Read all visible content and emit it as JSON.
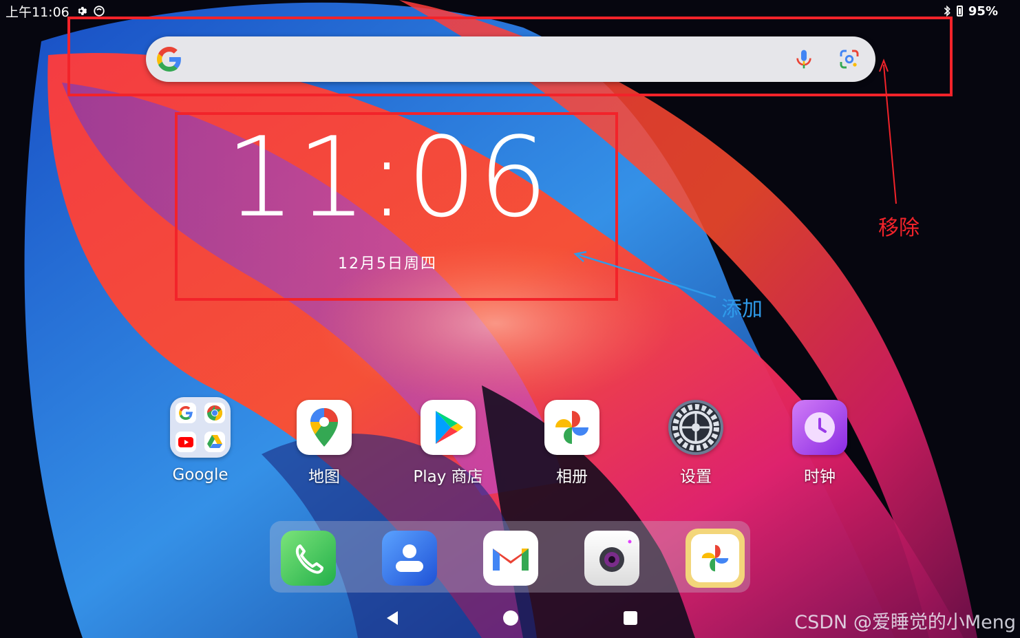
{
  "status_bar": {
    "time": "上午11:06",
    "battery": "95%",
    "icons": [
      "gear-icon",
      "sync-icon",
      "bluetooth-icon",
      "battery-icon"
    ]
  },
  "search_bar": {
    "icons": [
      "google-g-icon",
      "mic-icon",
      "google-lens-icon"
    ]
  },
  "clock_widget": {
    "time": "11:06",
    "date": "12月5日周四"
  },
  "annotations": {
    "remove_label": "移除",
    "add_label": "添加",
    "colors": {
      "box": "#f2232a",
      "remove_text": "#f2232a",
      "add_text": "#2f9bea"
    }
  },
  "apps": [
    {
      "label": "Google",
      "icon": "google-folder-icon"
    },
    {
      "label": "地图",
      "icon": "maps-icon"
    },
    {
      "label": "Play 商店",
      "icon": "play-store-icon"
    },
    {
      "label": "相册",
      "icon": "photos-icon"
    },
    {
      "label": "设置",
      "icon": "settings-gear-icon"
    },
    {
      "label": "时钟",
      "icon": "clock-icon"
    }
  ],
  "dock": [
    "phone-icon",
    "contacts-icon",
    "gmail-icon",
    "camera-icon",
    "photos-icon"
  ],
  "nav": [
    "back-icon",
    "home-icon",
    "recents-icon"
  ],
  "watermark": "CSDN @爱睡觉的小Meng"
}
